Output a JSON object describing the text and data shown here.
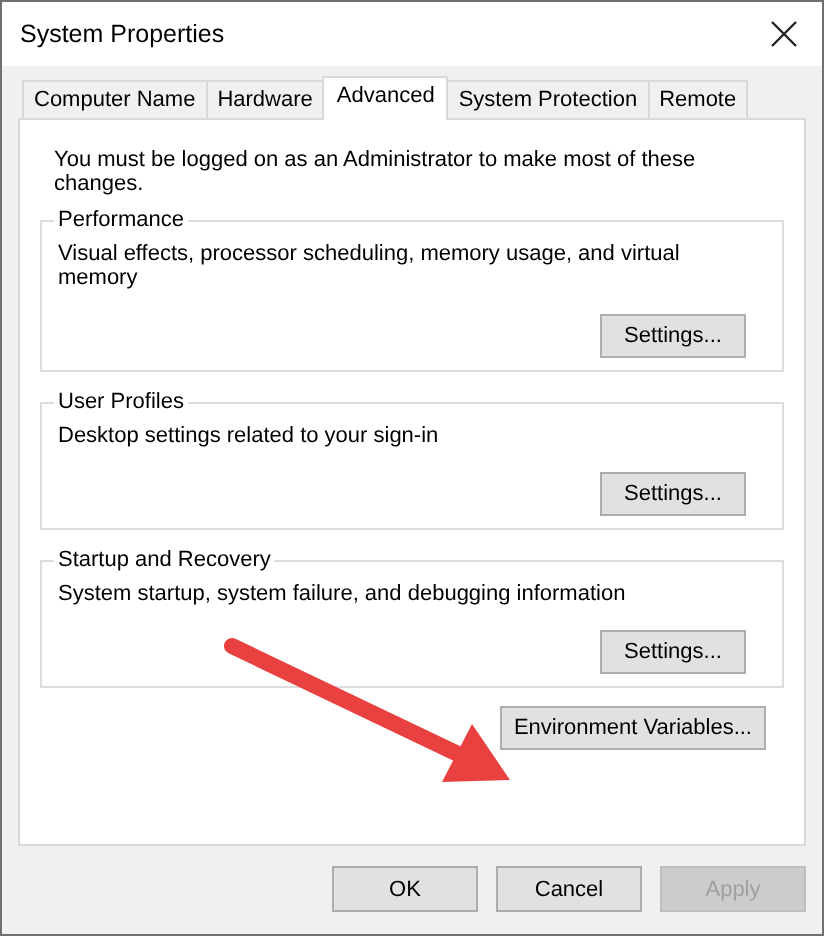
{
  "window": {
    "title": "System Properties"
  },
  "tabs": [
    {
      "label": "Computer Name",
      "selected": false
    },
    {
      "label": "Hardware",
      "selected": false
    },
    {
      "label": "Advanced",
      "selected": true
    },
    {
      "label": "System Protection",
      "selected": false
    },
    {
      "label": "Remote",
      "selected": false
    }
  ],
  "notice": "You must be logged on as an Administrator to make most of these changes.",
  "groups": [
    {
      "title": "Performance",
      "description": "Visual effects, processor scheduling, memory usage, and virtual memory",
      "button": "Settings..."
    },
    {
      "title": "User Profiles",
      "description": "Desktop settings related to your sign-in",
      "button": "Settings..."
    },
    {
      "title": "Startup and Recovery",
      "description": "System startup, system failure, and debugging information",
      "button": "Settings..."
    }
  ],
  "environment_button": "Environment Variables...",
  "buttons": [
    {
      "label": "OK",
      "disabled": false
    },
    {
      "label": "Cancel",
      "disabled": false
    },
    {
      "label": "Apply",
      "disabled": true
    }
  ]
}
